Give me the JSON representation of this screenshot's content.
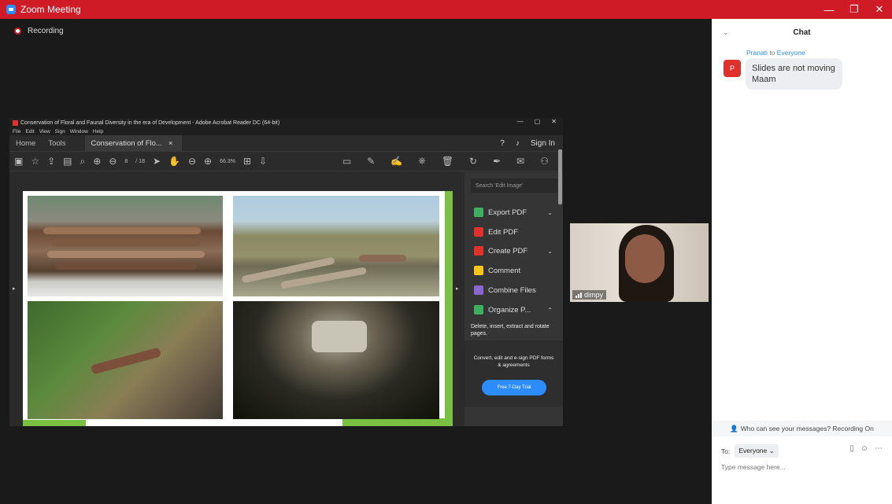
{
  "window": {
    "title": "Zoom Meeting",
    "controls": [
      "—",
      "❐",
      "✕"
    ]
  },
  "recording": {
    "label": "Recording"
  },
  "acrobat": {
    "title": "Conservation of Floral and Faunal Diversity in the era of Development - Adobe Acrobat Reader DC (64-bit)",
    "window_controls": [
      "—",
      "▢",
      "✕"
    ],
    "menu": [
      "File",
      "Edit",
      "View",
      "Sign",
      "Window",
      "Help"
    ],
    "tabs": {
      "home": "Home",
      "tools": "Tools",
      "document": "Conservation of Flo...",
      "close": "×"
    },
    "sign_in": "Sign In",
    "page_current": "8",
    "page_total": "/ 18",
    "zoom": "66.3%",
    "search_placeholder": "Search 'Edit Image'",
    "tools": [
      {
        "label": "Export PDF",
        "color": "#3fb05f",
        "chev": "⌄"
      },
      {
        "label": "Edit PDF",
        "color": "#e0312c",
        "chev": ""
      },
      {
        "label": "Create PDF",
        "color": "#e0312c",
        "chev": "⌄"
      },
      {
        "label": "Comment",
        "color": "#f5c518",
        "chev": ""
      },
      {
        "label": "Combine Files",
        "color": "#8a66d1",
        "chev": ""
      },
      {
        "label": "Organize P...",
        "color": "#3fb05f",
        "chev": "⌃"
      }
    ],
    "organize_desc": "Delete, insert, extract and rotate pages.",
    "promo_text": "Convert, edit and e-sign PDF forms & agreements",
    "trial_button": "Free 7-Day Trial"
  },
  "video": {
    "name": "dimpy"
  },
  "chat": {
    "title": "Chat",
    "sender": "Pranati",
    "to_word": "to",
    "recipient": "Everyone",
    "avatar_initial": "P",
    "message": "Slides are not moving Maam",
    "who_can_see": "Who can see your messages? Recording On",
    "to_label": "To:",
    "to_select": "Everyone ⌄",
    "input_placeholder": "Type message here..."
  }
}
